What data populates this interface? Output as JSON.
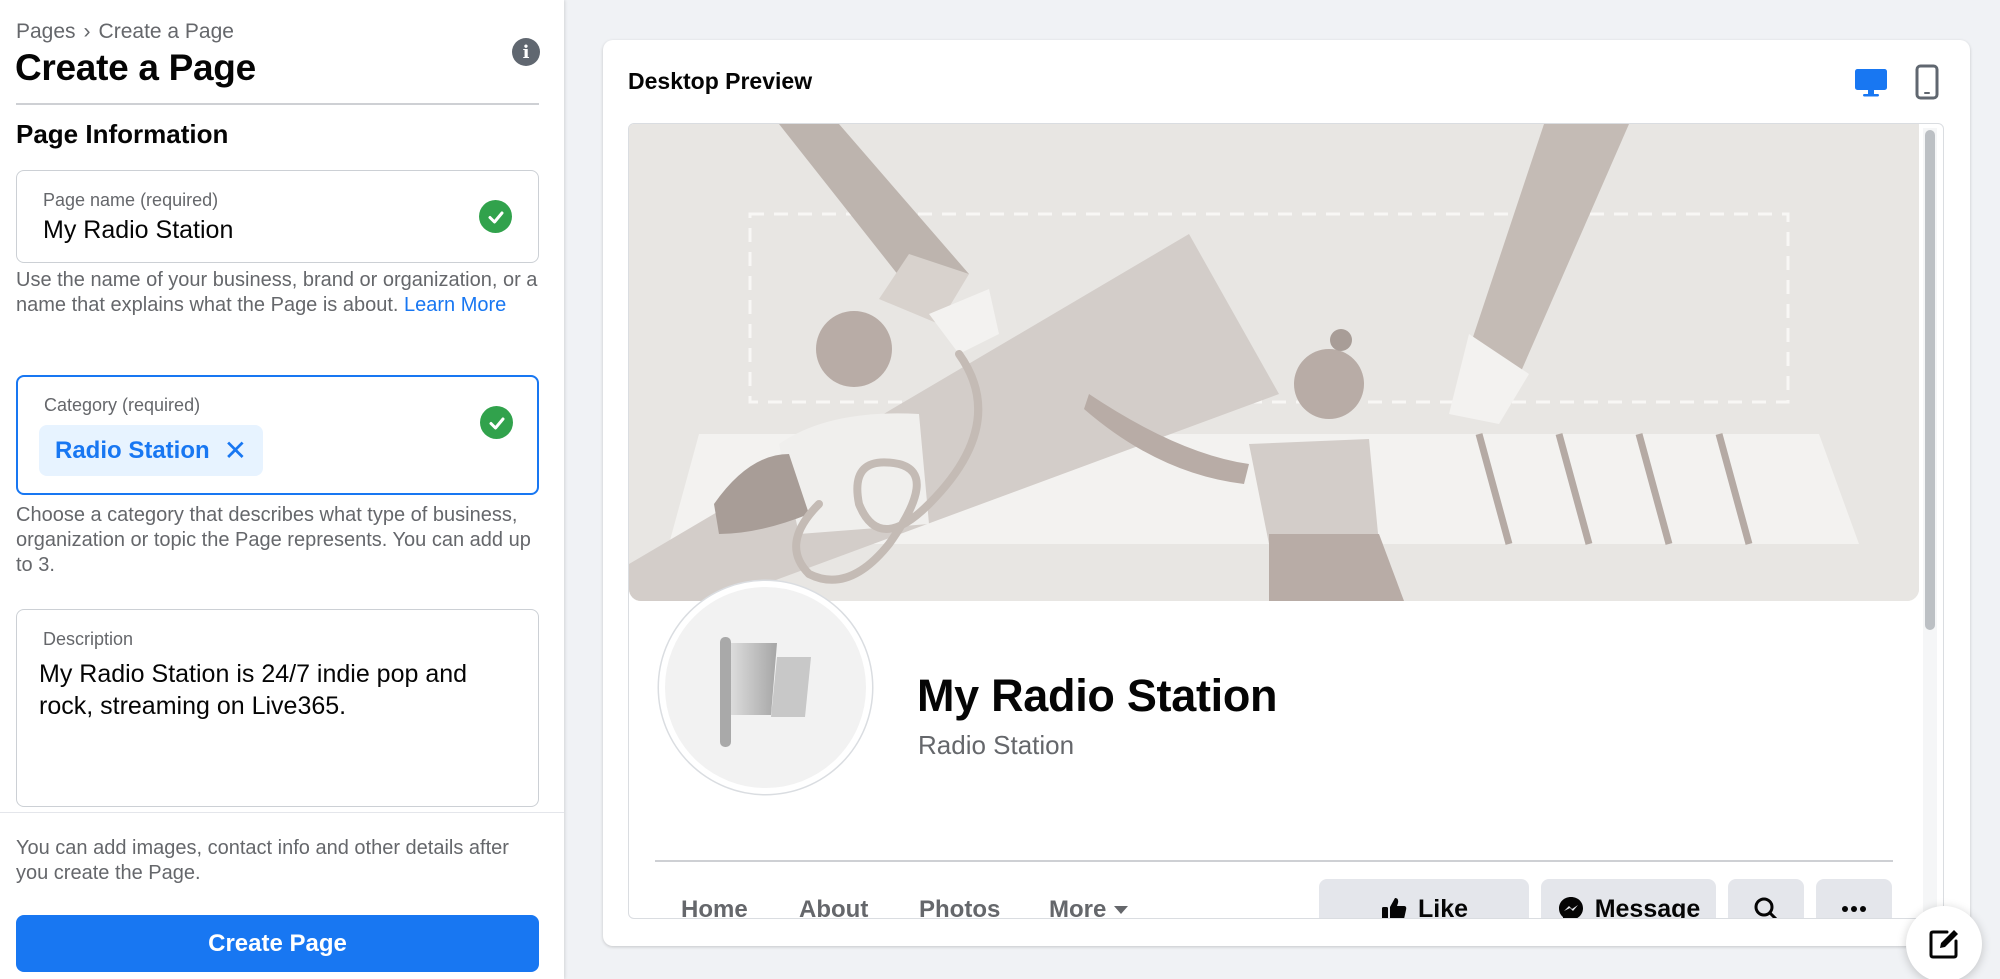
{
  "breadcrumb": {
    "parent": "Pages",
    "separator": "›",
    "current": "Create a Page"
  },
  "page_title": "Create a Page",
  "section_title": "Page Information",
  "page_name_field": {
    "label": "Page name (required)",
    "value": "My Radio Station"
  },
  "page_name_help": {
    "text": "Use the name of your business, brand or organization, or a name that explains what the Page is about. ",
    "link": "Learn More"
  },
  "category_field": {
    "label": "Category (required)",
    "chip": "Radio Station",
    "chip_remove": "✕"
  },
  "category_help": "Choose a category that describes what type of business, organization or topic the Page represents. You can add up to 3.",
  "description_field": {
    "label": "Description",
    "value": "My Radio Station is 24/7 indie pop and rock, streaming on Live365."
  },
  "footer_note": "You can add images, contact info and other details after you create the Page.",
  "create_button": "Create Page",
  "preview": {
    "title": "Desktop Preview",
    "profile_name": "My Radio Station",
    "profile_category": "Radio Station",
    "tabs": [
      "Home",
      "About",
      "Photos",
      "More"
    ],
    "actions": {
      "like": "Like",
      "message": "Message"
    }
  },
  "colors": {
    "accent": "#1877f2",
    "success": "#31a24c",
    "muted": "#65676b",
    "background": "#f0f2f5"
  },
  "icons": [
    "info-icon",
    "check-icon",
    "desktop-icon",
    "mobile-icon",
    "flag-icon",
    "like-icon",
    "messenger-icon",
    "search-icon",
    "more-icon",
    "compose-icon"
  ]
}
